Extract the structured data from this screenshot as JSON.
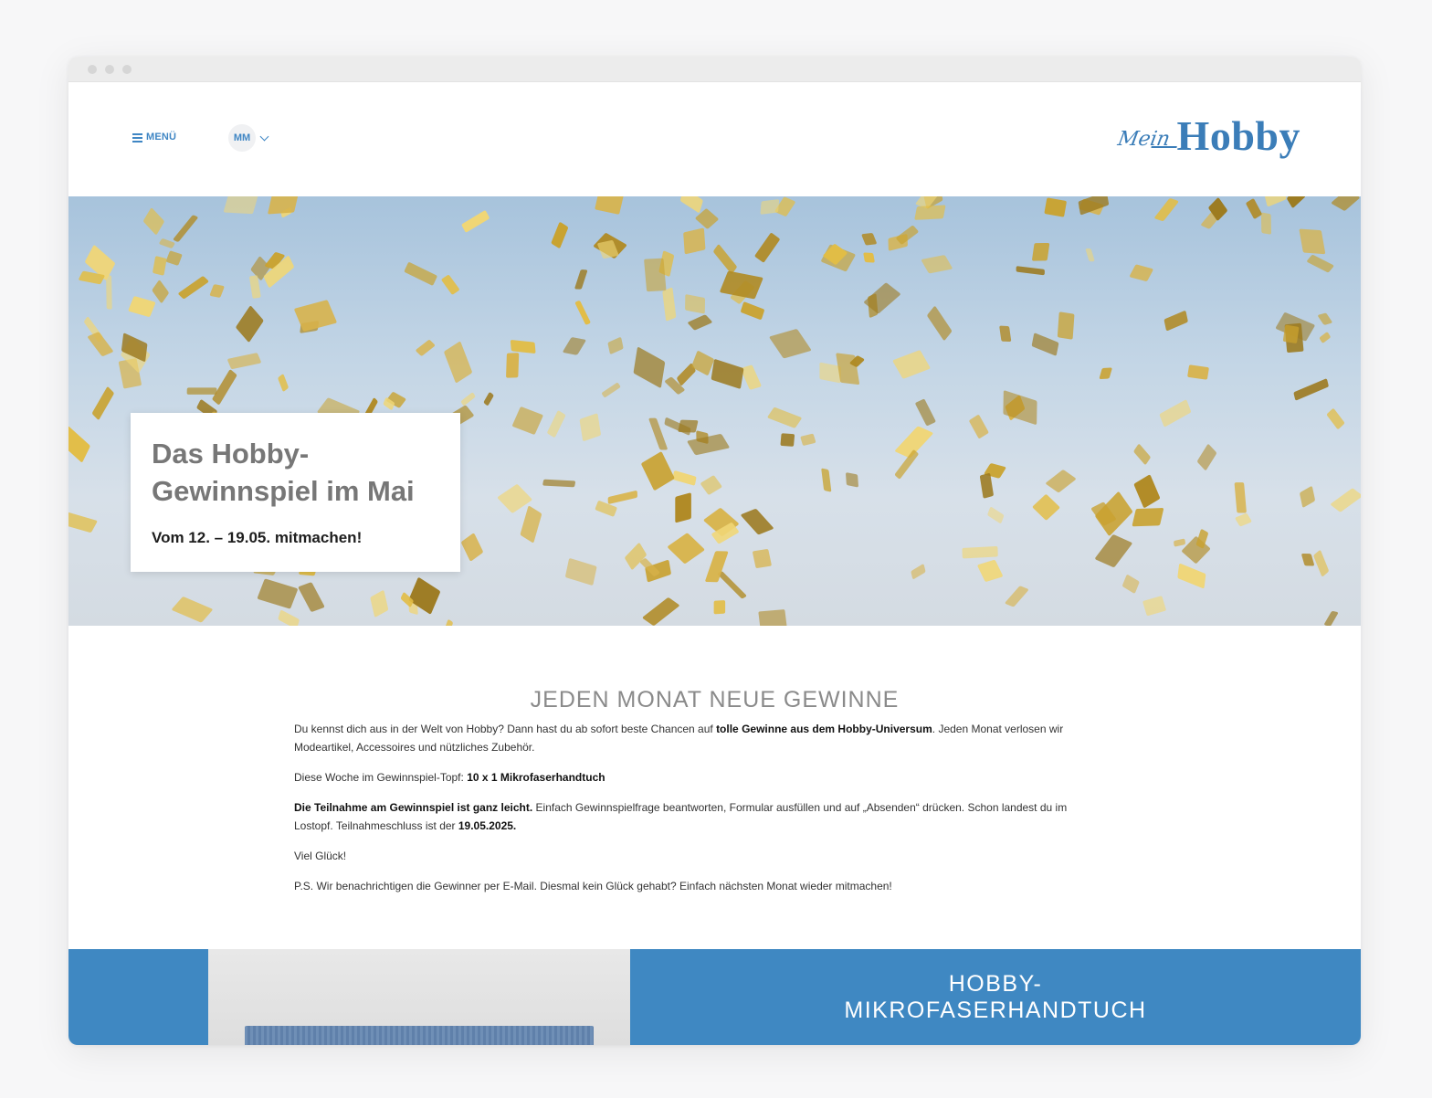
{
  "header": {
    "menu_label": "MENÜ",
    "avatar_initials": "MM",
    "logo_script": "Mein",
    "logo_main": "Hobby"
  },
  "hero": {
    "title": "Das Hobby-Gewinnspiel im Mai",
    "subtitle": "Vom 12. – 19.05. mitmachen!"
  },
  "content": {
    "section_title": "JEDEN MONAT NEUE GEWINNE",
    "p1_a": "Du kennst dich aus in der Welt von Hobby? Dann hast du ab sofort beste Chancen auf ",
    "p1_b": "tolle Gewinne aus dem Hobby-Universum",
    "p1_c": ". Jeden Monat verlosen wir Modeartikel, Accessoires und nützliches Zubehör.",
    "p2_a": "Diese Woche im Gewinnspiel-Topf: ",
    "p2_b": "10 x 1 Mikrofaserhandtuch",
    "p3_a": "Die Teilnahme am Gewinnspiel ist ganz leicht.",
    "p3_b": " Einfach Gewinnspielfrage beantworten, Formular ausfüllen und auf „Absenden“ drücken. Schon landest du im Lostopf. Teilnahmeschluss ist der ",
    "p3_c": "19.05.2025.",
    "p4": "Viel Glück!",
    "p5": "P.S. Wir benachrichtigen die Gewinner per E-Mail. Diesmal kein Glück gehabt? Einfach nächsten Monat wieder mitmachen!"
  },
  "product": {
    "title_line1": "HOBBY-",
    "title_line2": "MIKROFASERHANDTUCH"
  },
  "colors": {
    "accent": "#3f88c2",
    "logo": "#3b7db8"
  }
}
